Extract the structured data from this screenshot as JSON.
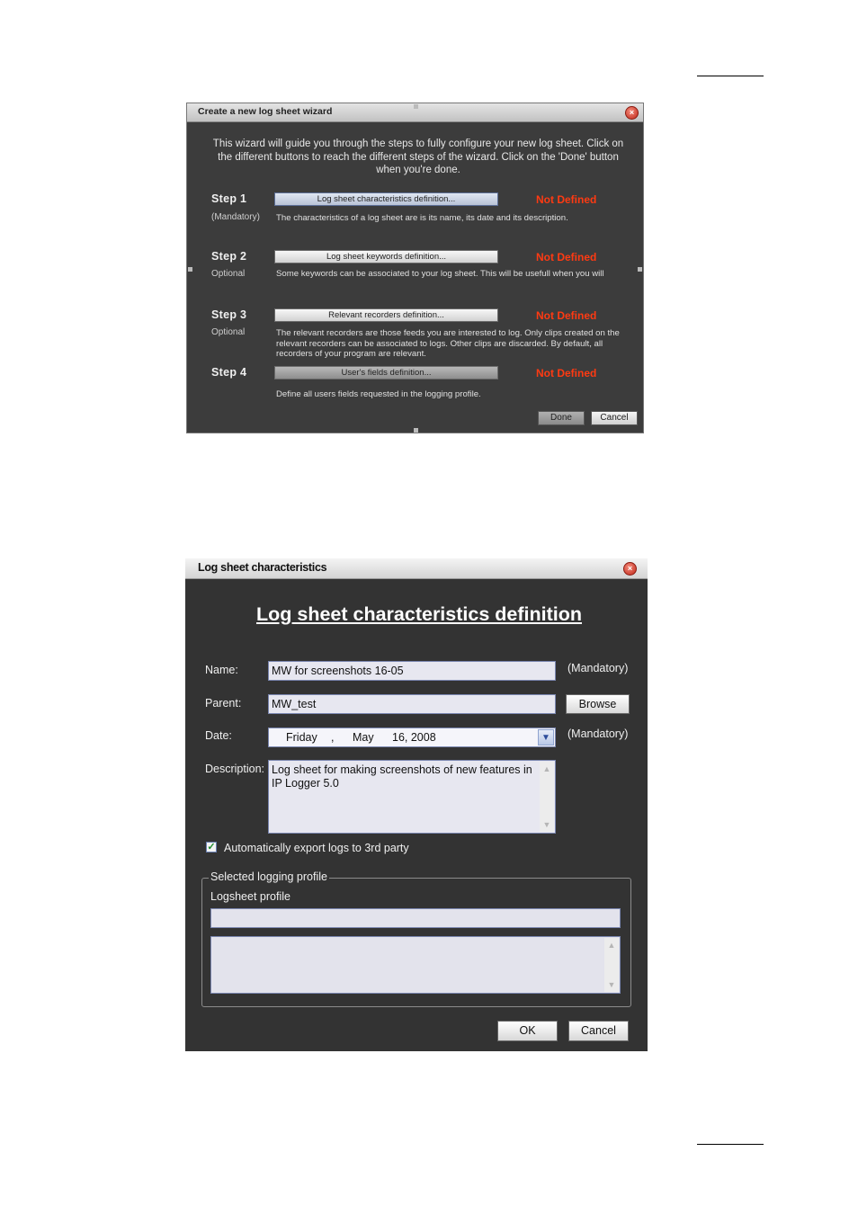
{
  "wizard": {
    "title": "Create a new log sheet wizard",
    "close_icon": "close-icon",
    "intro": "This wizard will guide you through the steps to fully configure your new log sheet. Click on the different buttons to reach the different steps of the wizard. Click on the 'Done' button when you're done.",
    "steps": [
      {
        "title": "Step 1",
        "sub": "(Mandatory)",
        "button": "Log sheet characteristics definition...",
        "status": "Not Defined",
        "desc": "The characteristics of a log sheet are is its name, its date and its description."
      },
      {
        "title": "Step 2",
        "sub": "Optional",
        "button": "Log sheet keywords definition...",
        "status": "Not Defined",
        "desc": "Some keywords can be associated to your log sheet. This will be usefull when you will"
      },
      {
        "title": "Step 3",
        "sub": "Optional",
        "button": "Relevant recorders definition...",
        "status": "Not Defined",
        "desc": "The relevant recorders are those feeds you are interested to log. Only clips created on the relevant recorders can be associated to logs. Other clips are discarded. By default, all recorders of your program are relevant."
      },
      {
        "title": "Step 4",
        "sub": "",
        "button": "User's fields definition...",
        "status": "Not Defined",
        "desc": "Define all users fields requested in the logging profile."
      }
    ],
    "done_label": "Done",
    "cancel_label": "Cancel",
    "status_color": "#ff3a12"
  },
  "characteristics": {
    "window_title": "Log sheet characteristics",
    "heading": "Log sheet characteristics definition",
    "name_label": "Name:",
    "name_value": "MW for screenshots 16-05",
    "name_mandatory": "(Mandatory)",
    "parent_label": "Parent:",
    "parent_value": "MW_test",
    "browse_label": "Browse",
    "date_label": "Date:",
    "date_day": "Friday",
    "date_sep": ",",
    "date_month": "May",
    "date_rest": "16, 2008",
    "date_mandatory": "(Mandatory)",
    "description_label": "Description:",
    "description_value": "Log sheet for making screenshots of new features in IP Logger 5.0",
    "auto_export_label": "Automatically export logs to 3rd party",
    "auto_export_checked": true,
    "group_label": "Selected logging profile",
    "logsheet_profile_label": "Logsheet profile",
    "logsheet_profile_value": "",
    "ok_label": "OK",
    "cancel_label": "Cancel"
  }
}
